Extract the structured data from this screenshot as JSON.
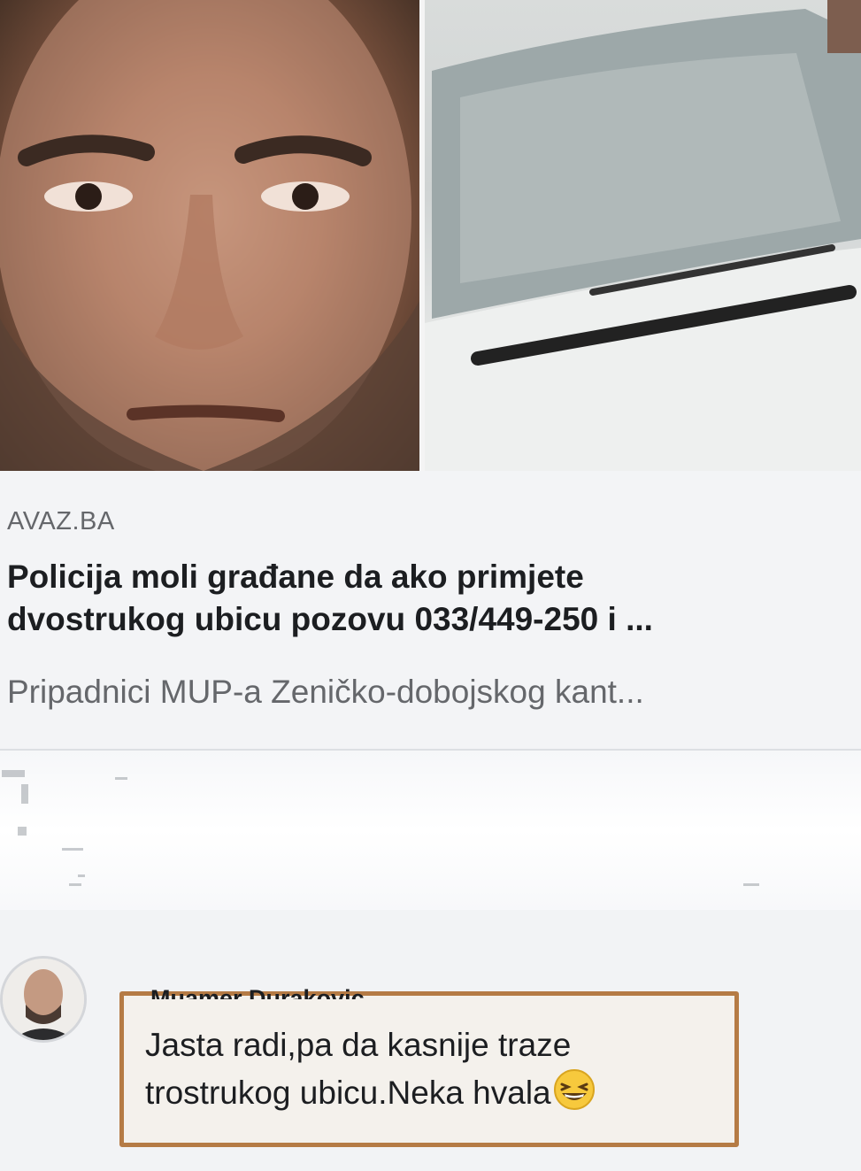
{
  "link_preview": {
    "image_left": "suspect portrait photo",
    "image_right": "white car windshield photo",
    "source": "AVAZ.BA",
    "headline_lines": [
      "Policija moli građane da ako primjete",
      "dvostrukog ubicu pozovu 033/449-250 i ..."
    ],
    "description": "Pripadnici MUP-a Zeničko-dobojskog kant..."
  },
  "comment": {
    "author": "Muamer Durakovic",
    "text_lines": [
      "Jasta radi,pa da kasnije traze",
      "trostrukog ubicu.Neka hvala"
    ],
    "emoji": "grinning-squinting-face-icon",
    "highlight_color": "#b57b45"
  }
}
